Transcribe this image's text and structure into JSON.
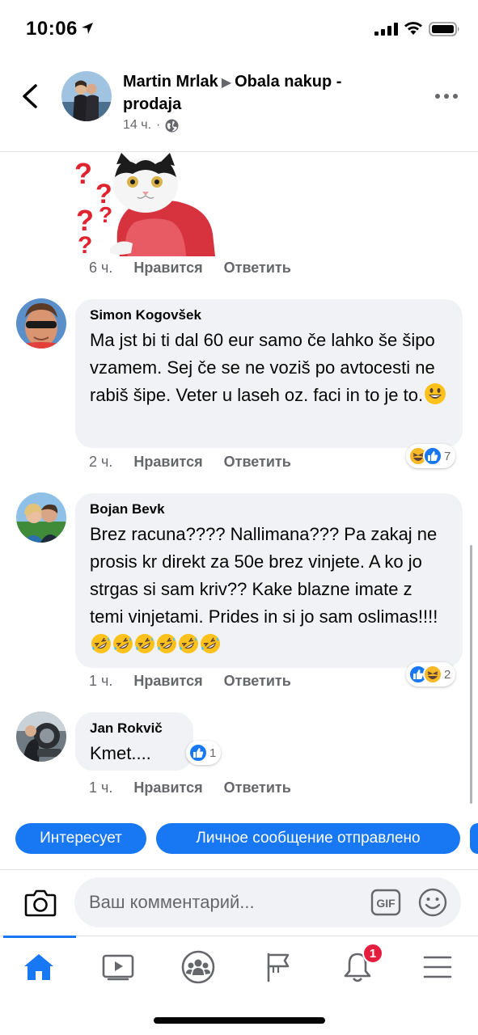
{
  "status_bar": {
    "time": "10:06"
  },
  "header": {
    "author": "Martin Mrlak",
    "group": "Obala nakup - prodaja",
    "time": "14 ч.",
    "separator": "·"
  },
  "sticker_comment": {
    "time": "6 ч.",
    "like_label": "Нравится",
    "reply_label": "Ответить"
  },
  "comments": [
    {
      "name": "Simon Kogovšek",
      "text": "Ma jst bi ti dal 60 eur samo če lahko še šipo vzamem. Sej če se ne voziš po avtocesti ne rabiš šipe. Veter u laseh oz. faci in to je to.",
      "trailing_emoji": "smiley",
      "time": "2 ч.",
      "like_label": "Нравится",
      "reply_label": "Ответить",
      "reactions": [
        "haha",
        "like"
      ],
      "reaction_count": "7"
    },
    {
      "name": "Bojan Bevk",
      "text": "Brez racuna???? Nallimana??? Pa zakaj ne prosis kr direkt za 50e brez vinjete. A ko jo strgas si sam kriv?? Kake blazne imate z temi vinjetami. Prides in si jo sam oslimas!!!!",
      "trailing_emoji": "rofl x6",
      "time": "1 ч.",
      "like_label": "Нравится",
      "reply_label": "Ответить",
      "reactions": [
        "like",
        "haha"
      ],
      "reaction_count": "2"
    },
    {
      "name": "Jan Rokvič",
      "text": "Kmet....",
      "time": "1 ч.",
      "like_label": "Нравится",
      "reply_label": "Ответить",
      "reactions": [
        "like"
      ],
      "reaction_count": "1"
    }
  ],
  "quick_replies": [
    "Интересует",
    "Личное сообщение отправлено"
  ],
  "composer": {
    "placeholder": "Ваш комментарий..."
  },
  "bottom_nav": {
    "items": [
      "home-icon",
      "watch-icon",
      "groups-icon",
      "pages-icon",
      "notifications-icon",
      "menu-icon"
    ],
    "notification_count": "1"
  },
  "colors": {
    "accent": "#1877f2",
    "bubble": "#f0f2f5",
    "muted": "#65676b",
    "badge": "#e41e3f"
  }
}
